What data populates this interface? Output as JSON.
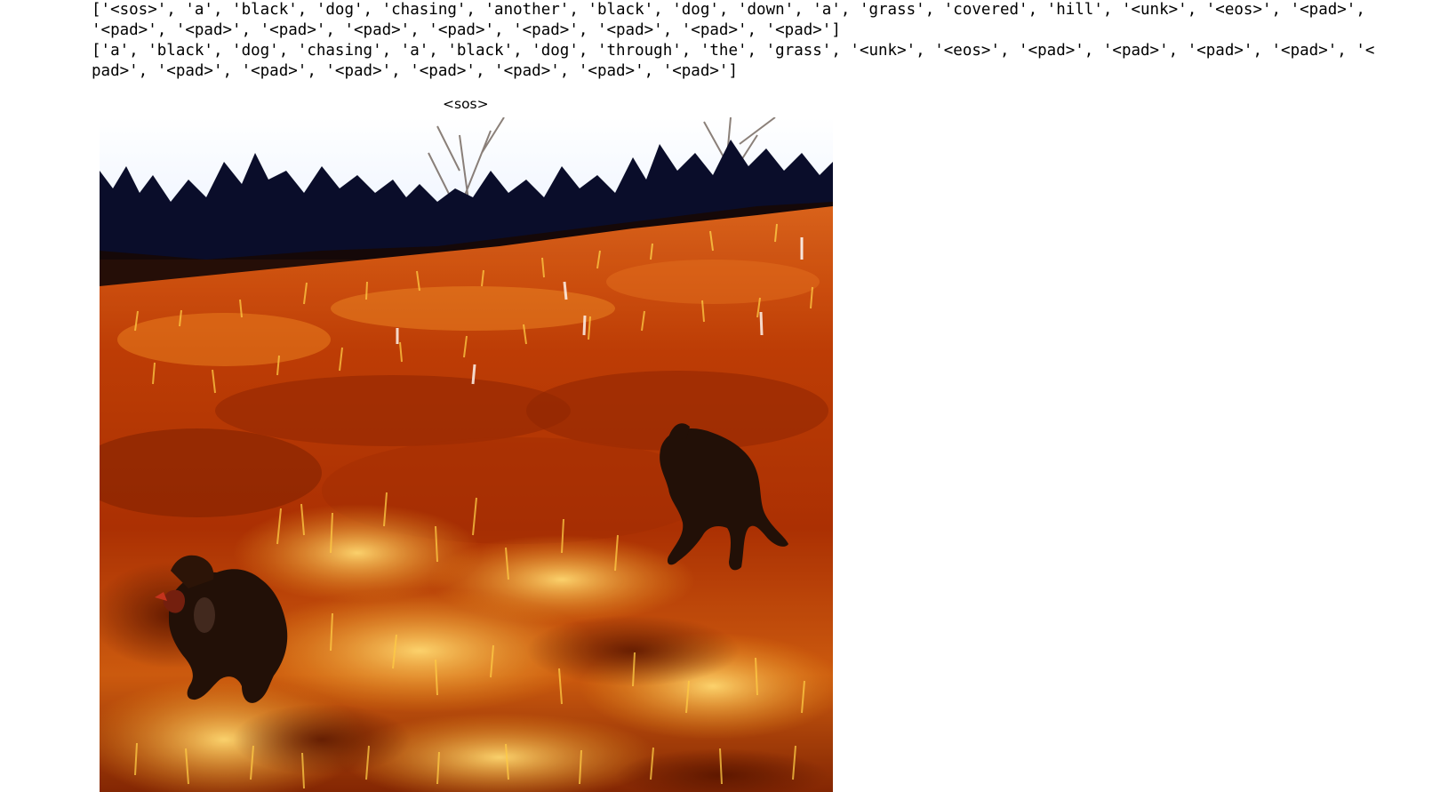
{
  "output": {
    "lines": [
      "['<sos>', 'a', 'black', 'dog', 'chasing', 'another', 'black', 'dog', 'down', 'a', 'grass', 'covered', 'hill', '<unk>', '<eos>', '<pad>',",
      "'<pad>', '<pad>', '<pad>', '<pad>', '<pad>', '<pad>', '<pad>', '<pad>', '<pad>']",
      "['a', 'black', 'dog', 'chasing', 'a', 'black', 'dog', 'through', 'the', 'grass', '<unk>', '<eos>', '<pad>', '<pad>', '<pad>', '<pad>', '<",
      "pad>', '<pad>', '<pad>', '<pad>', '<pad>', '<pad>', '<pad>', '<pad>']"
    ]
  },
  "plot": {
    "title": "<sos>"
  },
  "image": {
    "colors": {
      "sky": "#f4f8ff",
      "trees": "#0a0d2a",
      "grass_dark": "#6a1800",
      "grass_mid": "#c24a06",
      "grass_light": "#f2b22a",
      "dog": "#120a08"
    }
  }
}
